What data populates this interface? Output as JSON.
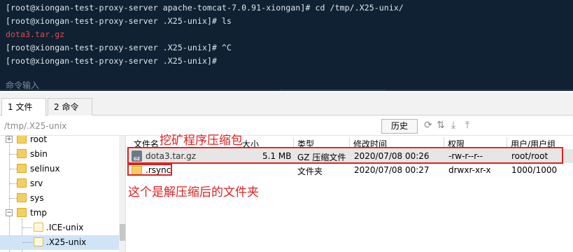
{
  "terminal": {
    "lines": [
      "[root@xiongan-test-proxy-server apache-tomcat-7.0.91-xiongan]# cd /tmp/.X25-unix/",
      "[root@xiongan-test-proxy-server .X25-unix]# ls",
      "dota3.tar.gz",
      "[root@xiongan-test-proxy-server .X25-unix]# ^C",
      "[root@xiongan-test-proxy-server .X25-unix]#"
    ],
    "command_input_placeholder": "命令输入",
    "colors": {
      "background": "#0f2133",
      "text": "#e3e8ee",
      "highlight": "#e14a4a"
    }
  },
  "tabs": [
    {
      "label": "1 文件",
      "active": true
    },
    {
      "label": "2 命令",
      "active": false
    }
  ],
  "pathbar": {
    "path": "/tmp/.X25-unix",
    "history_label": "历史",
    "icons": [
      "refresh-icon",
      "sync-icon",
      "download-icon",
      "upload-icon"
    ]
  },
  "tree": {
    "items": [
      {
        "label": "root",
        "expander": "+"
      },
      {
        "label": "sbin",
        "expander": ""
      },
      {
        "label": "selinux",
        "expander": ""
      },
      {
        "label": "srv",
        "expander": ""
      },
      {
        "label": "sys",
        "expander": ""
      },
      {
        "label": "tmp",
        "expander": "−"
      },
      {
        "label": ".ICE-unix",
        "expander": ""
      },
      {
        "label": ".X25-unix",
        "expander": "",
        "selected": true
      }
    ]
  },
  "filelist": {
    "columns": [
      "文件名",
      "大小",
      "类型",
      "修改时间",
      "权限",
      "用户/用户组"
    ],
    "rows": [
      {
        "name": "dota3.tar.gz",
        "size": "5.1 MB",
        "type": "GZ 压缩文件",
        "modified": "2020/07/08 00:26",
        "perms": "-rw-r--r--",
        "owner": "root/root",
        "icon": "gz-archive-icon"
      },
      {
        "name": ".rsync",
        "size": "",
        "type": "文件夹",
        "modified": "2020/07/08 00:27",
        "perms": "drwxr-xr-x",
        "owner": "1000/1000",
        "icon": "folder-icon"
      }
    ]
  },
  "annotations": {
    "archive_note": "挖矿程序压缩包",
    "folder_note": "这个是解压缩后的文件夹",
    "color": "#e02020"
  }
}
